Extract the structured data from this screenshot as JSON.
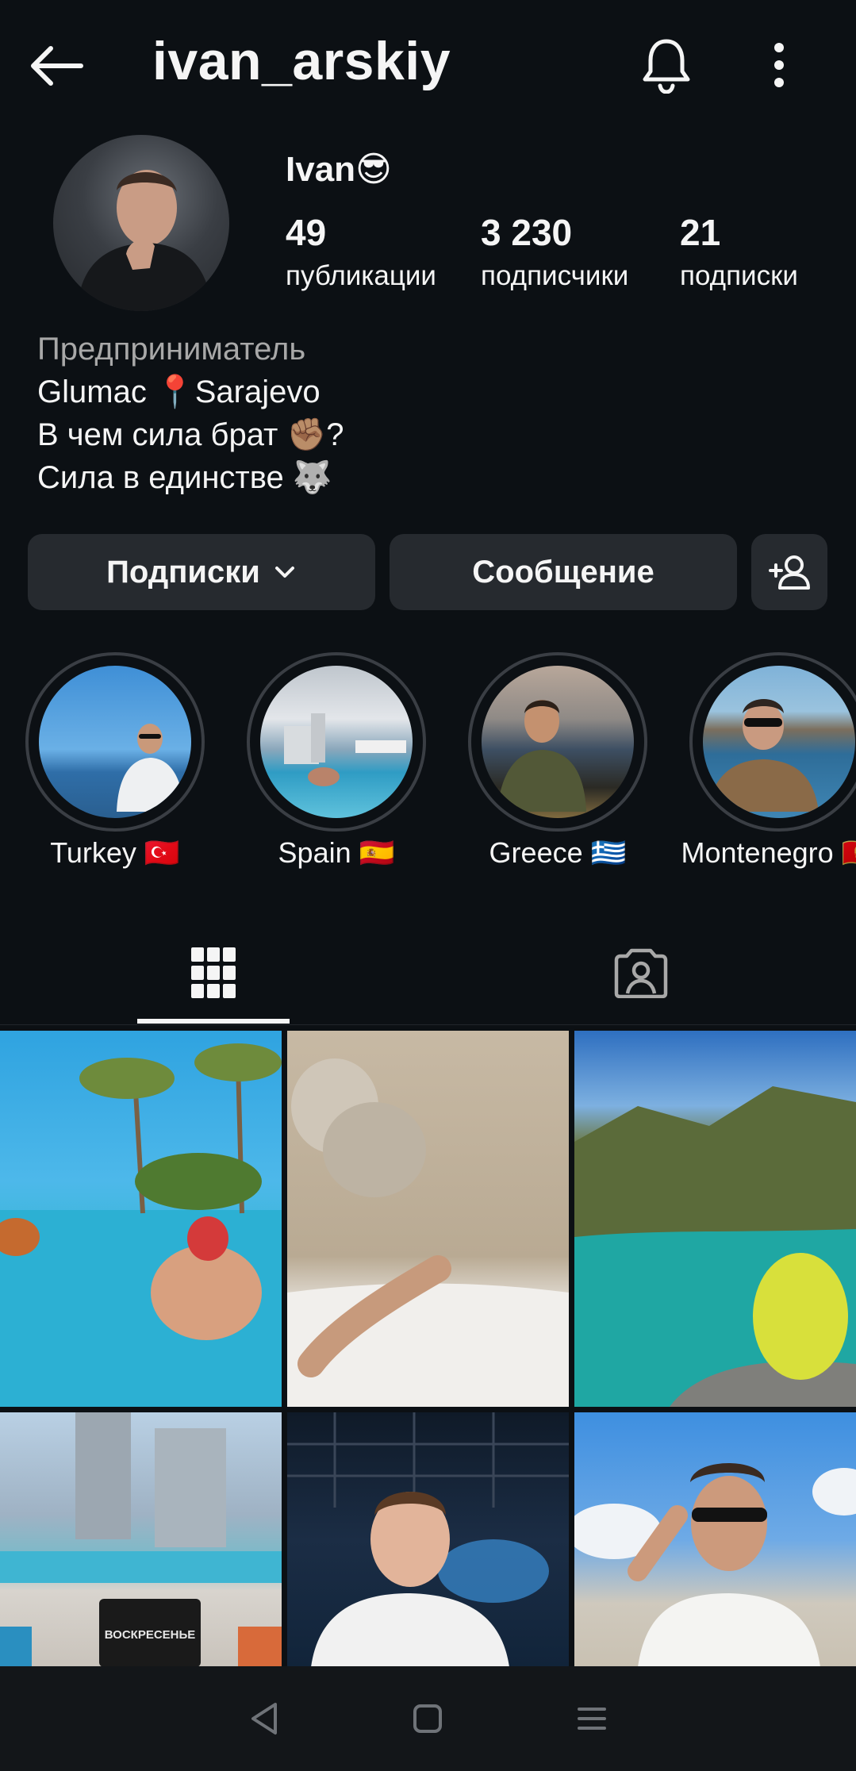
{
  "header": {
    "username": "ivan_arskiy"
  },
  "profile": {
    "display_name": "Ivan😎",
    "stats": [
      {
        "value": "49",
        "label": "публикации"
      },
      {
        "value": "3 230",
        "label": "подписчики"
      },
      {
        "value": "21",
        "label": "подписки"
      }
    ],
    "bio": {
      "category": "Предприниматель",
      "lines": [
        "Glumac 📍Sarajevo",
        "В чем сила брат ✊🏽?",
        "Сила в единстве 🐺"
      ]
    }
  },
  "actions": {
    "following_label": "Подписки",
    "message_label": "Сообщение"
  },
  "highlights": [
    {
      "label": "Turkey 🇹🇷"
    },
    {
      "label": "Spain 🇪🇸"
    },
    {
      "label": "Greece 🇬🇷"
    },
    {
      "label": "Montenegro 🇲🇪"
    }
  ],
  "grid": {
    "post_5_overlay_text": "ВОСКРЕСЕНЬЕ"
  },
  "icons": {
    "back": "back-arrow-icon",
    "bell": "bell-icon",
    "more": "more-vertical-icon",
    "chevron": "chevron-down-icon",
    "add_person": "add-person-icon",
    "grid_tab": "grid-icon",
    "tagged_tab": "tagged-icon"
  },
  "colors": {
    "background": "#0c1014",
    "button": "#262a2f",
    "text": "#f5f5f5",
    "muted": "#a8a8a8"
  }
}
